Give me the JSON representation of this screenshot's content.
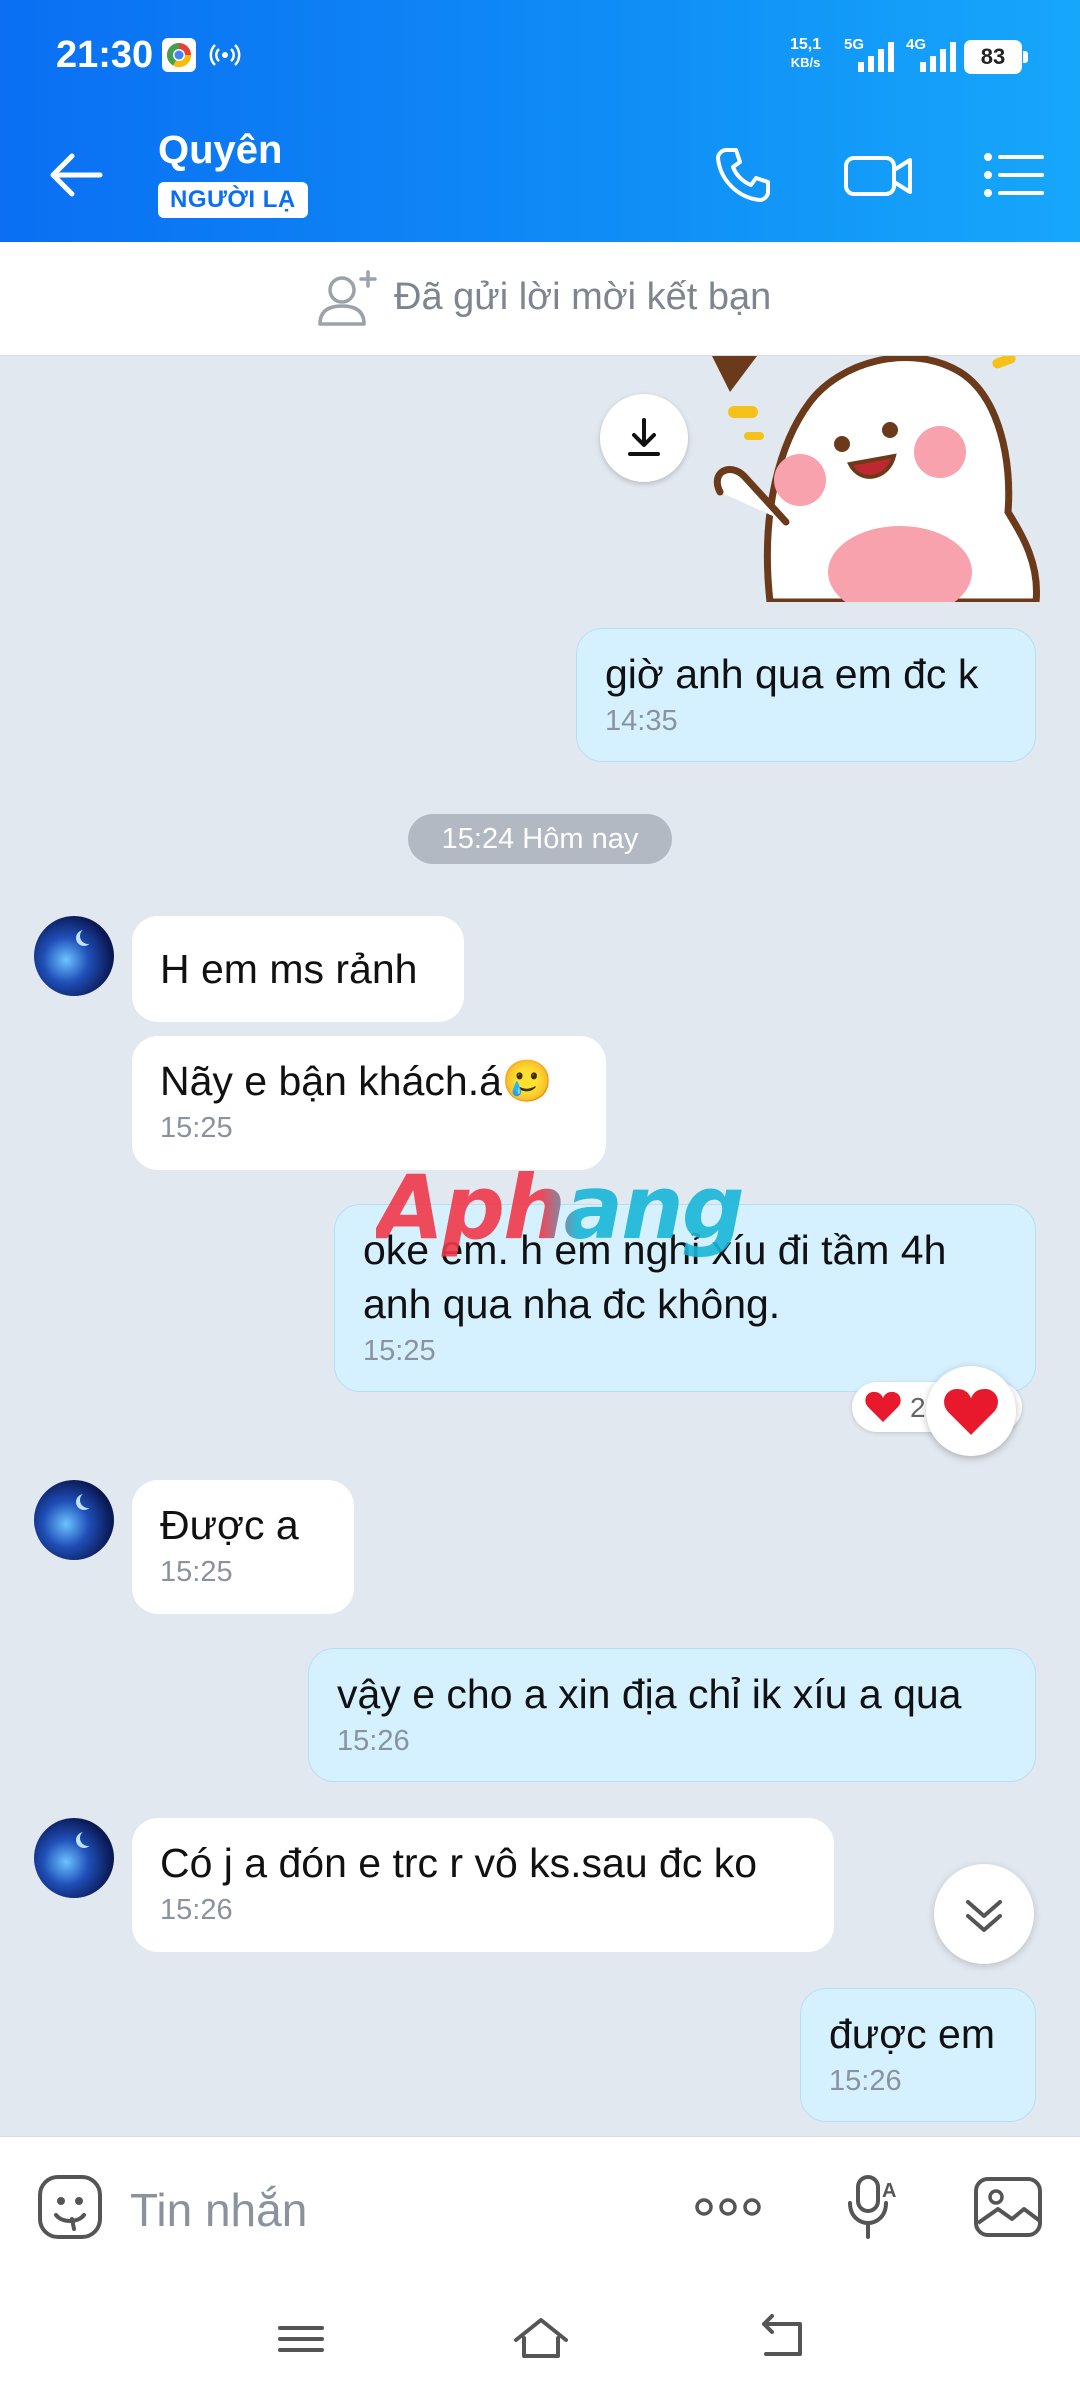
{
  "status_bar": {
    "time": "21:30",
    "net_speed_value": "15,1",
    "net_speed_unit": "KB/s",
    "sim1_label": "5G",
    "sim2_label": "4G",
    "battery": "83"
  },
  "header": {
    "contact_name": "Quyên",
    "stranger_badge": "NGƯỜI LẠ",
    "accent_color": "#0a6ff3"
  },
  "friend_request": {
    "text": "Đã gửi lời mời kết bạn"
  },
  "chat": {
    "date_separator": "15:24 Hôm nay",
    "messages": [
      {
        "dir": "out",
        "text": "giờ anh qua em đc k",
        "time": "14:35"
      },
      {
        "dir": "in",
        "text": "H em ms rảnh",
        "time": ""
      },
      {
        "dir": "in",
        "text": "Nãy e bận khách.á🥲",
        "time": "15:25"
      },
      {
        "dir": "out",
        "text": "oke em. h em nghỉ xíu đi tầm 4h\nanh qua nha đc không.",
        "time": "15:25"
      },
      {
        "dir": "in",
        "text": "Được a",
        "time": "15:25"
      },
      {
        "dir": "out",
        "text": "vậy e cho a xin địa chỉ ik xíu a qua",
        "time": "15:26"
      },
      {
        "dir": "in",
        "text": "Có j a đón e trc r vô ks.sau đc ko",
        "time": "15:26"
      },
      {
        "dir": "out",
        "text": "được em",
        "time": "15:26"
      }
    ],
    "reaction_count": "2",
    "watermark": "Aphang"
  },
  "input_bar": {
    "placeholder": "Tin nhắn"
  }
}
